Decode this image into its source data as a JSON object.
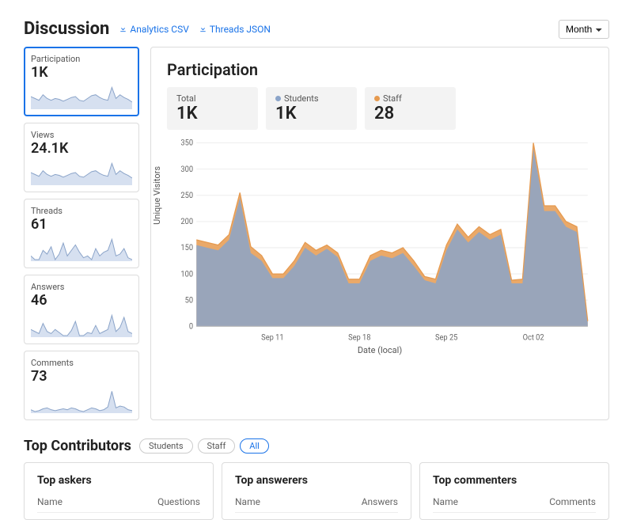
{
  "header": {
    "title": "Discussion",
    "analytics_link": "Analytics CSV",
    "threads_link": "Threads JSON",
    "period_selected": "Month"
  },
  "metrics": [
    {
      "label": "Participation",
      "value": "1K",
      "selected": true
    },
    {
      "label": "Views",
      "value": "24.1K",
      "selected": false
    },
    {
      "label": "Threads",
      "value": "61",
      "selected": false
    },
    {
      "label": "Answers",
      "value": "46",
      "selected": false
    },
    {
      "label": "Comments",
      "value": "73",
      "selected": false
    }
  ],
  "panel": {
    "title": "Participation",
    "stats": [
      {
        "label": "Total",
        "value": "1K",
        "dot": null
      },
      {
        "label": "Students",
        "value": "1K",
        "dot": "blue"
      },
      {
        "label": "Staff",
        "value": "28",
        "dot": "orange"
      }
    ],
    "ylabel": "Unique Visitors",
    "xlabel": "Date (local)"
  },
  "chart_data": {
    "type": "area",
    "xlabel": "Date (local)",
    "ylabel": "Unique Visitors",
    "ylim": [
      0,
      350
    ],
    "x_ticks": [
      "Sep 11",
      "Sep 18",
      "Sep 25",
      "Oct 02"
    ],
    "y_ticks": [
      0,
      50,
      100,
      150,
      200,
      250,
      300,
      350
    ],
    "series": [
      {
        "name": "Staff",
        "color": "#e69a4f",
        "values": [
          165,
          160,
          155,
          175,
          255,
          152,
          135,
          100,
          100,
          125,
          160,
          145,
          155,
          140,
          90,
          90,
          135,
          145,
          140,
          150,
          125,
          95,
          90,
          155,
          195,
          170,
          190,
          175,
          185,
          88,
          90,
          350,
          230,
          230,
          200,
          190,
          10
        ]
      },
      {
        "name": "Students",
        "color": "#8ba4c9",
        "values": [
          155,
          150,
          145,
          165,
          245,
          140,
          125,
          92,
          92,
          115,
          150,
          135,
          148,
          132,
          82,
          82,
          125,
          135,
          130,
          140,
          115,
          88,
          82,
          145,
          185,
          160,
          180,
          165,
          175,
          82,
          82,
          340,
          220,
          220,
          190,
          180,
          8
        ]
      }
    ]
  },
  "contributors": {
    "title": "Top Contributors",
    "filters": [
      {
        "label": "Students",
        "selected": false
      },
      {
        "label": "Staff",
        "selected": false
      },
      {
        "label": "All",
        "selected": true
      }
    ],
    "cards": [
      {
        "title": "Top askers",
        "col1": "Name",
        "col2": "Questions"
      },
      {
        "title": "Top answerers",
        "col1": "Name",
        "col2": "Answers"
      },
      {
        "title": "Top commenters",
        "col1": "Name",
        "col2": "Comments"
      }
    ]
  },
  "spark": {
    "participation": [
      12,
      10,
      8,
      14,
      10,
      8,
      10,
      9,
      7,
      9,
      11,
      12,
      8,
      7,
      10,
      13,
      14,
      11,
      9,
      8,
      22,
      10,
      14,
      11,
      9,
      6
    ],
    "views": [
      12,
      10,
      8,
      14,
      10,
      8,
      10,
      9,
      7,
      9,
      11,
      12,
      8,
      7,
      10,
      13,
      14,
      11,
      9,
      8,
      22,
      10,
      14,
      11,
      9,
      6
    ],
    "threads": [
      4,
      0,
      0,
      10,
      6,
      14,
      0,
      6,
      18,
      4,
      10,
      16,
      8,
      2,
      4,
      0,
      12,
      4,
      8,
      10,
      22,
      4,
      6,
      12,
      2,
      0
    ],
    "answers": [
      6,
      4,
      2,
      12,
      4,
      2,
      6,
      3,
      0,
      0,
      5,
      14,
      0,
      0,
      3,
      2,
      10,
      2,
      4,
      6,
      20,
      4,
      8,
      18,
      4,
      2
    ],
    "comments": [
      2,
      0,
      1,
      3,
      4,
      2,
      1,
      2,
      3,
      2,
      4,
      3,
      1,
      0,
      2,
      4,
      3,
      1,
      2,
      5,
      22,
      4,
      6,
      5,
      2,
      1
    ]
  }
}
